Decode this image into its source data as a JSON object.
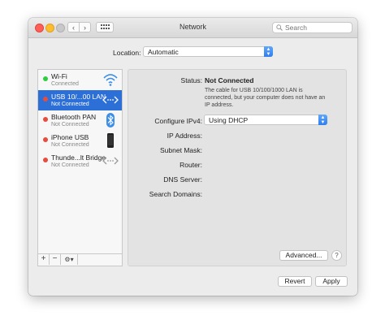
{
  "window": {
    "title": "Network",
    "search_placeholder": "Search"
  },
  "location": {
    "label": "Location:",
    "value": "Automatic"
  },
  "services": [
    {
      "name": "Wi-Fi",
      "status": "Connected",
      "dot_color": "#2ecc40",
      "icon": "wifi-icon",
      "selected": false
    },
    {
      "name": "USB 10/...00 LAN",
      "status": "Not Connected",
      "dot_color": "#e74c3c",
      "icon": "ethernet-icon",
      "selected": true
    },
    {
      "name": "Bluetooth PAN",
      "status": "Not Connected",
      "dot_color": "#e74c3c",
      "icon": "bluetooth-icon",
      "selected": false
    },
    {
      "name": "iPhone USB",
      "status": "Not Connected",
      "dot_color": "#e74c3c",
      "icon": "iphone-icon",
      "selected": false
    },
    {
      "name": "Thunde...lt Bridge",
      "status": "Not Connected",
      "dot_color": "#e74c3c",
      "icon": "ethernet-icon",
      "selected": false
    }
  ],
  "detail": {
    "status_label": "Status:",
    "status_value": "Not Connected",
    "status_desc": "The cable for USB 10/100/1000 LAN is connected, but your computer does not have an IP address.",
    "configure_label": "Configure IPv4:",
    "configure_value": "Using DHCP",
    "ip_label": "IP Address:",
    "subnet_label": "Subnet Mask:",
    "router_label": "Router:",
    "dns_label": "DNS Server:",
    "search_domains_label": "Search Domains:"
  },
  "buttons": {
    "advanced": "Advanced...",
    "help": "?",
    "revert": "Revert",
    "apply": "Apply",
    "add": "+",
    "remove": "−"
  },
  "colors": {
    "selection": "#2c6fd6",
    "accent": "#2f7ef0"
  }
}
